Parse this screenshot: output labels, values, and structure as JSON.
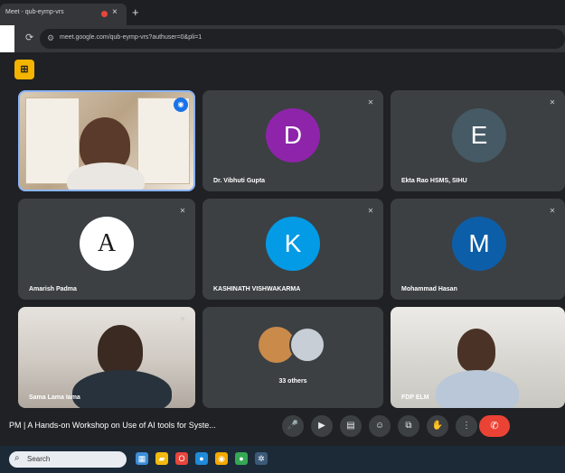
{
  "browser": {
    "tab_title": "Meet - qub-eymp-vrs",
    "new_tab": "+",
    "close": "×",
    "url": "meet.google.com/qub-eymp-vrs?authuser=0&pli=1"
  },
  "meet": {
    "logo_glyph": "⊞",
    "tiles": [
      {
        "name": "",
        "type": "video"
      },
      {
        "name": "Dr. Vibhuti Gupta",
        "initial": "D",
        "avatar_color": "#8e24aa"
      },
      {
        "name": "Ekta Rao HSMS, SIHU",
        "initial": "E",
        "avatar_color": "#455a64"
      },
      {
        "name": "Amarish Padma",
        "initial": "A",
        "avatar_color": "#ffffff"
      },
      {
        "name": "KASHINATH VISHWAKARMA",
        "initial": "K",
        "avatar_color": "#039be5"
      },
      {
        "name": "Mohammad Hasan",
        "initial": "M",
        "avatar_color": "#0d5ea8"
      },
      {
        "name": "Sama Lama Iama",
        "type": "video"
      },
      {
        "name": "33 others",
        "type": "others"
      },
      {
        "name": "FDP ELM",
        "type": "video"
      }
    ],
    "meeting_title": "PM  |  A Hands-on Workshop on Use of AI tools for Syste...",
    "controls": [
      "🎤",
      "▶",
      "▤",
      "☺",
      "⧉",
      "✋",
      "⋮"
    ],
    "end_call": "✆"
  },
  "taskbar": {
    "search_label": "Search",
    "icons": [
      {
        "glyph": "▦",
        "color": "#3b8ed8"
      },
      {
        "glyph": "▰",
        "color": "#f2b90f"
      },
      {
        "glyph": "O",
        "color": "#e8453c"
      },
      {
        "glyph": "●",
        "color": "#1f8ad8"
      },
      {
        "glyph": "◉",
        "color": "#f4a800"
      },
      {
        "glyph": "●",
        "color": "#34a853"
      },
      {
        "glyph": "✲",
        "color": "#8ab4f8"
      }
    ]
  },
  "colors": {
    "meet_bg": "#202124",
    "tile_bg": "#3c4043",
    "end_call": "#ea4335"
  }
}
